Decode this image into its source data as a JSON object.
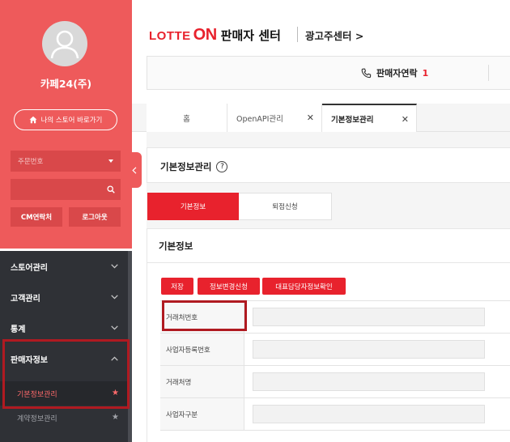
{
  "sidebar": {
    "shop_name": "카페24(주)",
    "store_button": "나의 스토어 바로가기",
    "order_select_placeholder": "주문번호",
    "cm_button": "CM연락처",
    "logout_button": "로그아웃",
    "menu": [
      {
        "label": "스토어관리"
      },
      {
        "label": "고객관리"
      },
      {
        "label": "통계"
      },
      {
        "label": "판매자정보"
      }
    ],
    "submenu": [
      {
        "label": "기본정보관리"
      },
      {
        "label": "계약정보관리"
      }
    ]
  },
  "header": {
    "logo_lotte": "LOTTE",
    "logo_on": "ON",
    "logo_seller": "판매자 센터",
    "ad_center": "광고주센터 >",
    "contact_label": "판매자연락",
    "contact_number": "1"
  },
  "tabs": [
    {
      "label": "홈"
    },
    {
      "label": "OpenAPI관리"
    },
    {
      "label": "기본정보관리"
    }
  ],
  "page": {
    "title": "기본정보관리",
    "help": "?",
    "sub_tabs": [
      {
        "label": "기본정보"
      },
      {
        "label": "퇴점신청"
      }
    ],
    "section_title": "기본정보",
    "buttons": {
      "save": "저장",
      "change": "정보변경신청",
      "rep": "대표담당자정보확인"
    },
    "fields": [
      {
        "label": "거래처번호"
      },
      {
        "label": "사업자등록번호"
      },
      {
        "label": "거래처명"
      },
      {
        "label": "사업자구분"
      }
    ]
  },
  "colors": {
    "brand_red": "#e8222d",
    "sidebar_red": "#ee5a5b",
    "sidebar_dark": "#2f3136",
    "highlight": "#b01a21"
  }
}
